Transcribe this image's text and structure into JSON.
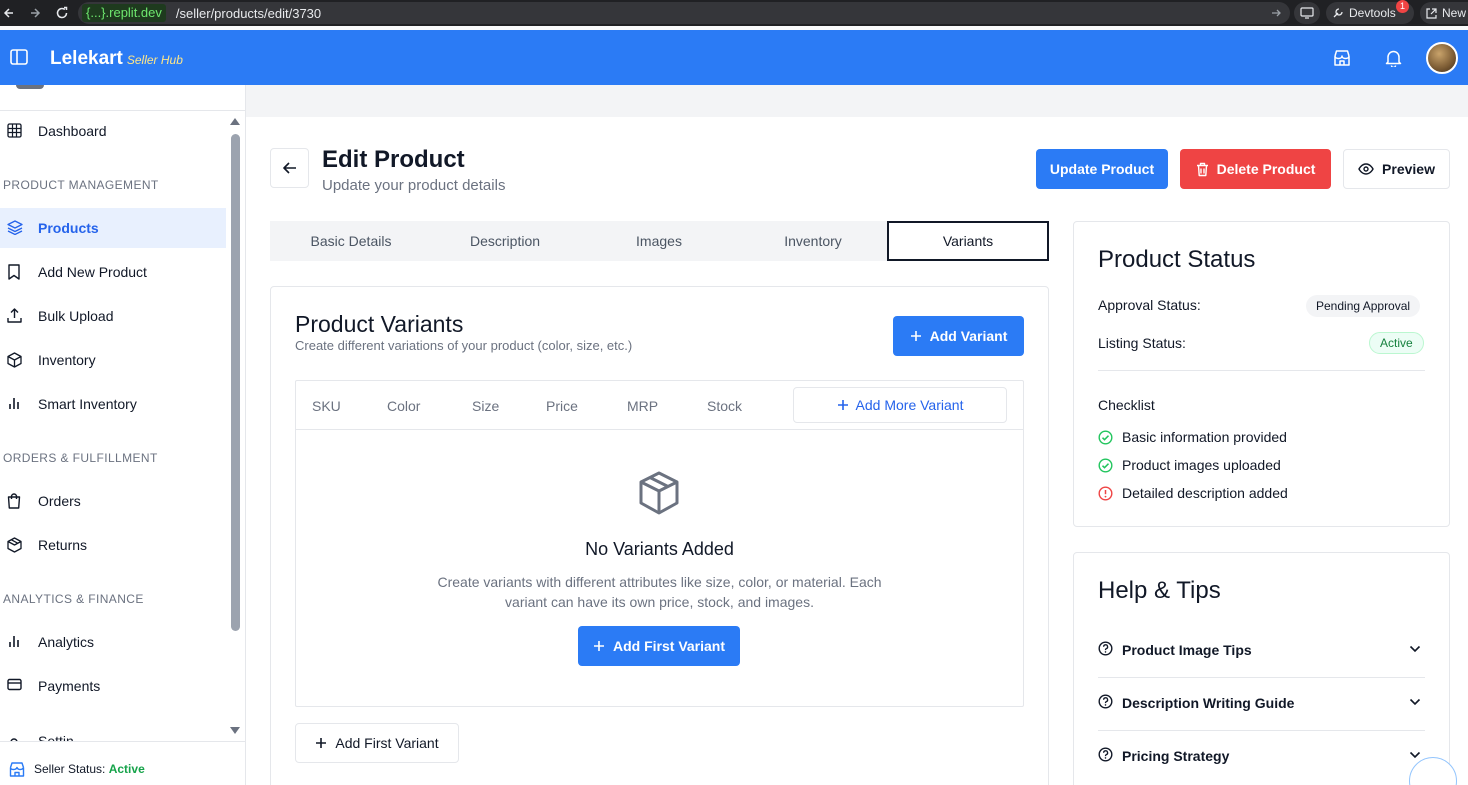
{
  "browser": {
    "url_host": "{...}.replit.dev",
    "url_path": "/seller/products/edit/3730",
    "devtools_label": "Devtools",
    "devtools_badge": "1",
    "new_tab_label": "New t"
  },
  "header": {
    "brand_name": "Lelekart",
    "brand_sub": "Seller Hub",
    "accent": "#2b7bf5"
  },
  "sidebar": {
    "items": [
      {
        "label": "Dashboard",
        "icon": "grid-icon"
      },
      {
        "label": "Products",
        "icon": "layers-icon",
        "active": true
      },
      {
        "label": "Add New Product",
        "icon": "bookmark-icon"
      },
      {
        "label": "Bulk Upload",
        "icon": "upload-icon"
      },
      {
        "label": "Inventory",
        "icon": "box-icon"
      },
      {
        "label": "Smart Inventory",
        "icon": "bar-chart-icon"
      },
      {
        "label": "Orders",
        "icon": "shopping-bag-icon"
      },
      {
        "label": "Returns",
        "icon": "package-return-icon"
      },
      {
        "label": "Analytics",
        "icon": "bar-chart-icon"
      },
      {
        "label": "Payments",
        "icon": "credit-card-icon"
      },
      {
        "label": "Settin",
        "icon": "gear-icon"
      }
    ],
    "sections": {
      "product_management": "PRODUCT MANAGEMENT",
      "orders_fulfillment": "ORDERS & FULFILLMENT",
      "analytics_finance": "ANALYTICS & FINANCE"
    },
    "footer": {
      "label": "Seller Status:",
      "value": "Active"
    }
  },
  "page": {
    "title": "Edit Product",
    "subtitle": "Update your product details",
    "actions": {
      "update": "Update Product",
      "delete": "Delete Product",
      "preview": "Preview"
    },
    "tabs": [
      {
        "label": "Basic Details"
      },
      {
        "label": "Description"
      },
      {
        "label": "Images"
      },
      {
        "label": "Inventory"
      },
      {
        "label": "Variants",
        "active": true
      }
    ]
  },
  "variants": {
    "title": "Product Variants",
    "subtitle": "Create different variations of your product (color, size, etc.)",
    "add_variant": "Add Variant",
    "columns": [
      "SKU",
      "Color",
      "Size",
      "Price",
      "MRP",
      "Stock"
    ],
    "add_more": "Add More Variant",
    "empty_title": "No Variants Added",
    "empty_desc": "Create variants with different attributes like size, color, or material. Each variant can have its own price, stock, and images.",
    "add_first_primary": "Add First Variant",
    "add_first_outline": "Add First Variant"
  },
  "status": {
    "title": "Product Status",
    "approval_label": "Approval Status:",
    "approval_value": "Pending Approval",
    "listing_label": "Listing Status:",
    "listing_value": "Active",
    "checklist_title": "Checklist",
    "checklist": [
      {
        "label": "Basic information provided",
        "state": "done"
      },
      {
        "label": "Product images uploaded",
        "state": "done"
      },
      {
        "label": "Detailed description added",
        "state": "missing"
      }
    ]
  },
  "help": {
    "title": "Help & Tips",
    "items": [
      {
        "label": "Product Image Tips"
      },
      {
        "label": "Description Writing Guide"
      },
      {
        "label": "Pricing Strategy"
      }
    ]
  }
}
